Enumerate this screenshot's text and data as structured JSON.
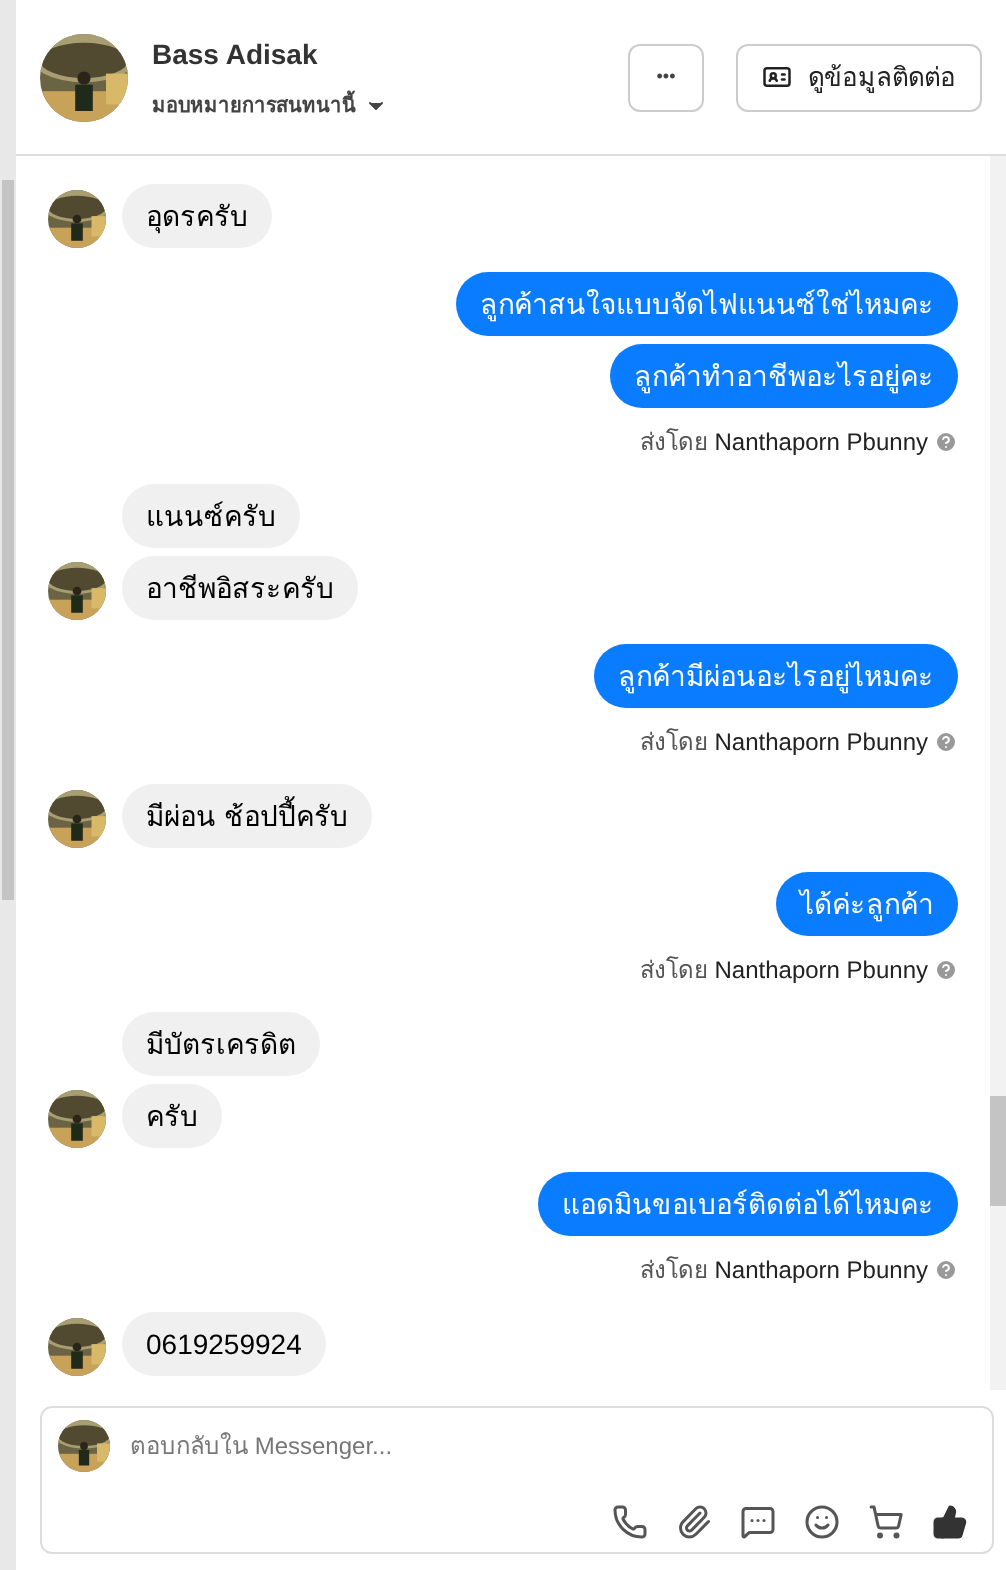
{
  "header": {
    "name": "Bass Adisak",
    "assign": "มอบหมายการสนทนานี้",
    "more": "•••",
    "contact": "ดูข้อมูลติดต่อ"
  },
  "groups": [
    {
      "kind": "incoming",
      "messages": [
        "อุดรครับ"
      ]
    },
    {
      "kind": "outgoing",
      "messages": [
        "ลูกค้าสนใจแบบจัดไฟแนนซ์ใช่ไหมคะ",
        "ลูกค้าทำอาชีพอะไรอยู่คะ"
      ],
      "sent_label": "ส่งโดย",
      "sender": "Nanthaporn Pbunny"
    },
    {
      "kind": "incoming",
      "messages": [
        "แนนซ์ครับ",
        "อาชีพอิสระครับ"
      ]
    },
    {
      "kind": "outgoing",
      "messages": [
        "ลูกค้ามีผ่อนอะไรอยู่ไหมคะ"
      ],
      "sent_label": "ส่งโดย",
      "sender": "Nanthaporn Pbunny"
    },
    {
      "kind": "incoming",
      "messages": [
        "มีผ่อน ช้อปปี้ครับ"
      ]
    },
    {
      "kind": "outgoing",
      "messages": [
        "ได้ค่ะลูกค้า"
      ],
      "sent_label": "ส่งโดย",
      "sender": "Nanthaporn Pbunny"
    },
    {
      "kind": "incoming",
      "messages": [
        "มีบัตรเครดิต",
        "ครับ"
      ]
    },
    {
      "kind": "outgoing",
      "messages": [
        "แอดมินขอเบอร์ติดต่อได้ไหมคะ"
      ],
      "sent_label": "ส่งโดย",
      "sender": "Nanthaporn Pbunny"
    },
    {
      "kind": "incoming",
      "messages": [
        "0619259924"
      ]
    }
  ],
  "composer": {
    "placeholder": "ตอบกลับใน Messenger..."
  }
}
